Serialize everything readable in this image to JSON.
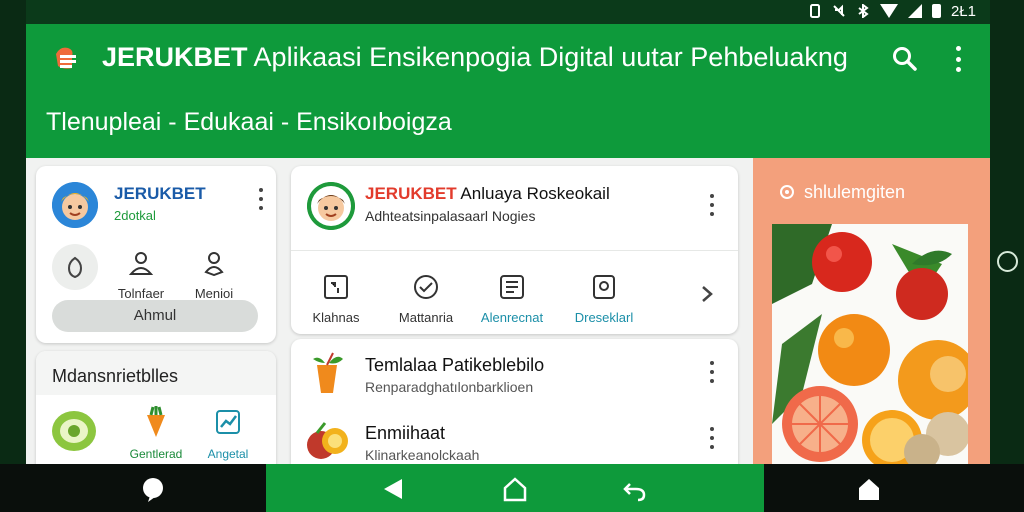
{
  "status": {
    "time": "2Ł1"
  },
  "appbar": {
    "brand": "JERUKBET",
    "title_rest": "Aplikaasi Ensikenpogia Digital uutar Pehbeluakng",
    "subtitle": "Tlenupleai - Edukaai - Ensikoıboigza"
  },
  "profile": {
    "name": "JERUKBET",
    "sub": "2dotkal",
    "actions": [
      {
        "label": "",
        "icon": "shield-icon"
      },
      {
        "label": "Tolnfaer",
        "icon": "person-icon"
      },
      {
        "label": "Menioi",
        "icon": "person-pin-icon"
      }
    ],
    "button": "Ahmul"
  },
  "categories": {
    "header": "Mdansnrietblles",
    "items": [
      {
        "label": "",
        "icon": "melon-icon"
      },
      {
        "label": "Gentlerad",
        "icon": "carrot-icon"
      },
      {
        "label": "Angetal",
        "icon": "chart-icon"
      }
    ]
  },
  "feature": {
    "brand": "JERUKBET",
    "title_rest": "Anluaya Roskeokail",
    "sub": "Adhteatsinpalasaarl Nogies",
    "nav": [
      {
        "label": "Klahnas",
        "icon": "grid-icon",
        "color": "#444444"
      },
      {
        "label": "Mattanria",
        "icon": "emoji-icon",
        "color": "#444444"
      },
      {
        "label": "Alenrecnat",
        "icon": "list-icon",
        "color": "#1b8fa8"
      },
      {
        "label": "Dreseklarl",
        "icon": "device-icon",
        "color": "#1b8fa8"
      }
    ]
  },
  "list": [
    {
      "title": "Temlalaa Patikeblebilo",
      "sub": "Renparadghatılonbarklioen",
      "icon": "juice-icon"
    },
    {
      "title": "Enmiihaat",
      "sub": "Klinarkeanolckaah",
      "icon": "fruit-icon"
    }
  ],
  "side": {
    "header": "shlulemgiten"
  },
  "colors": {
    "primary": "#0e9a3b",
    "accent": "#ef6a3a",
    "side_bg": "#f3a07c",
    "link": "#1b8fa8"
  }
}
